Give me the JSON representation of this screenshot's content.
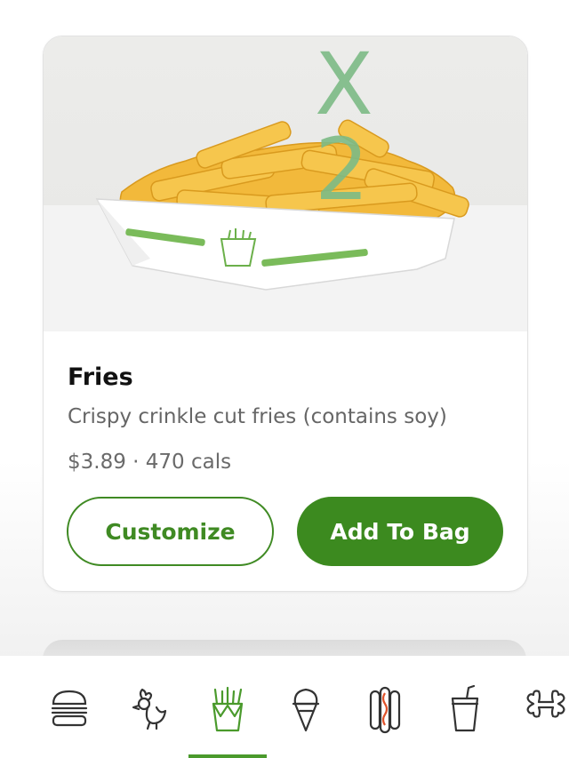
{
  "product": {
    "image_overlay": "X 2",
    "name": "Fries",
    "description": "Crispy crinkle cut fries (contains soy)",
    "price_and_calories": "$3.89 · 470 cals",
    "customize_label": "Customize",
    "add_to_bag_label": "Add To Bag"
  },
  "tabs": [
    {
      "name": "burger-icon",
      "active": false
    },
    {
      "name": "chicken-icon",
      "active": false
    },
    {
      "name": "fries-icon",
      "active": true
    },
    {
      "name": "ice-cream-icon",
      "active": false
    },
    {
      "name": "hot-dog-icon",
      "active": false
    },
    {
      "name": "drink-icon",
      "active": false
    },
    {
      "name": "dog-bone-icon",
      "active": false
    }
  ],
  "colors": {
    "accent": "#3c8a1f",
    "overlay_green": "#7dbb86",
    "text_primary": "#111111",
    "text_secondary": "#666666"
  }
}
